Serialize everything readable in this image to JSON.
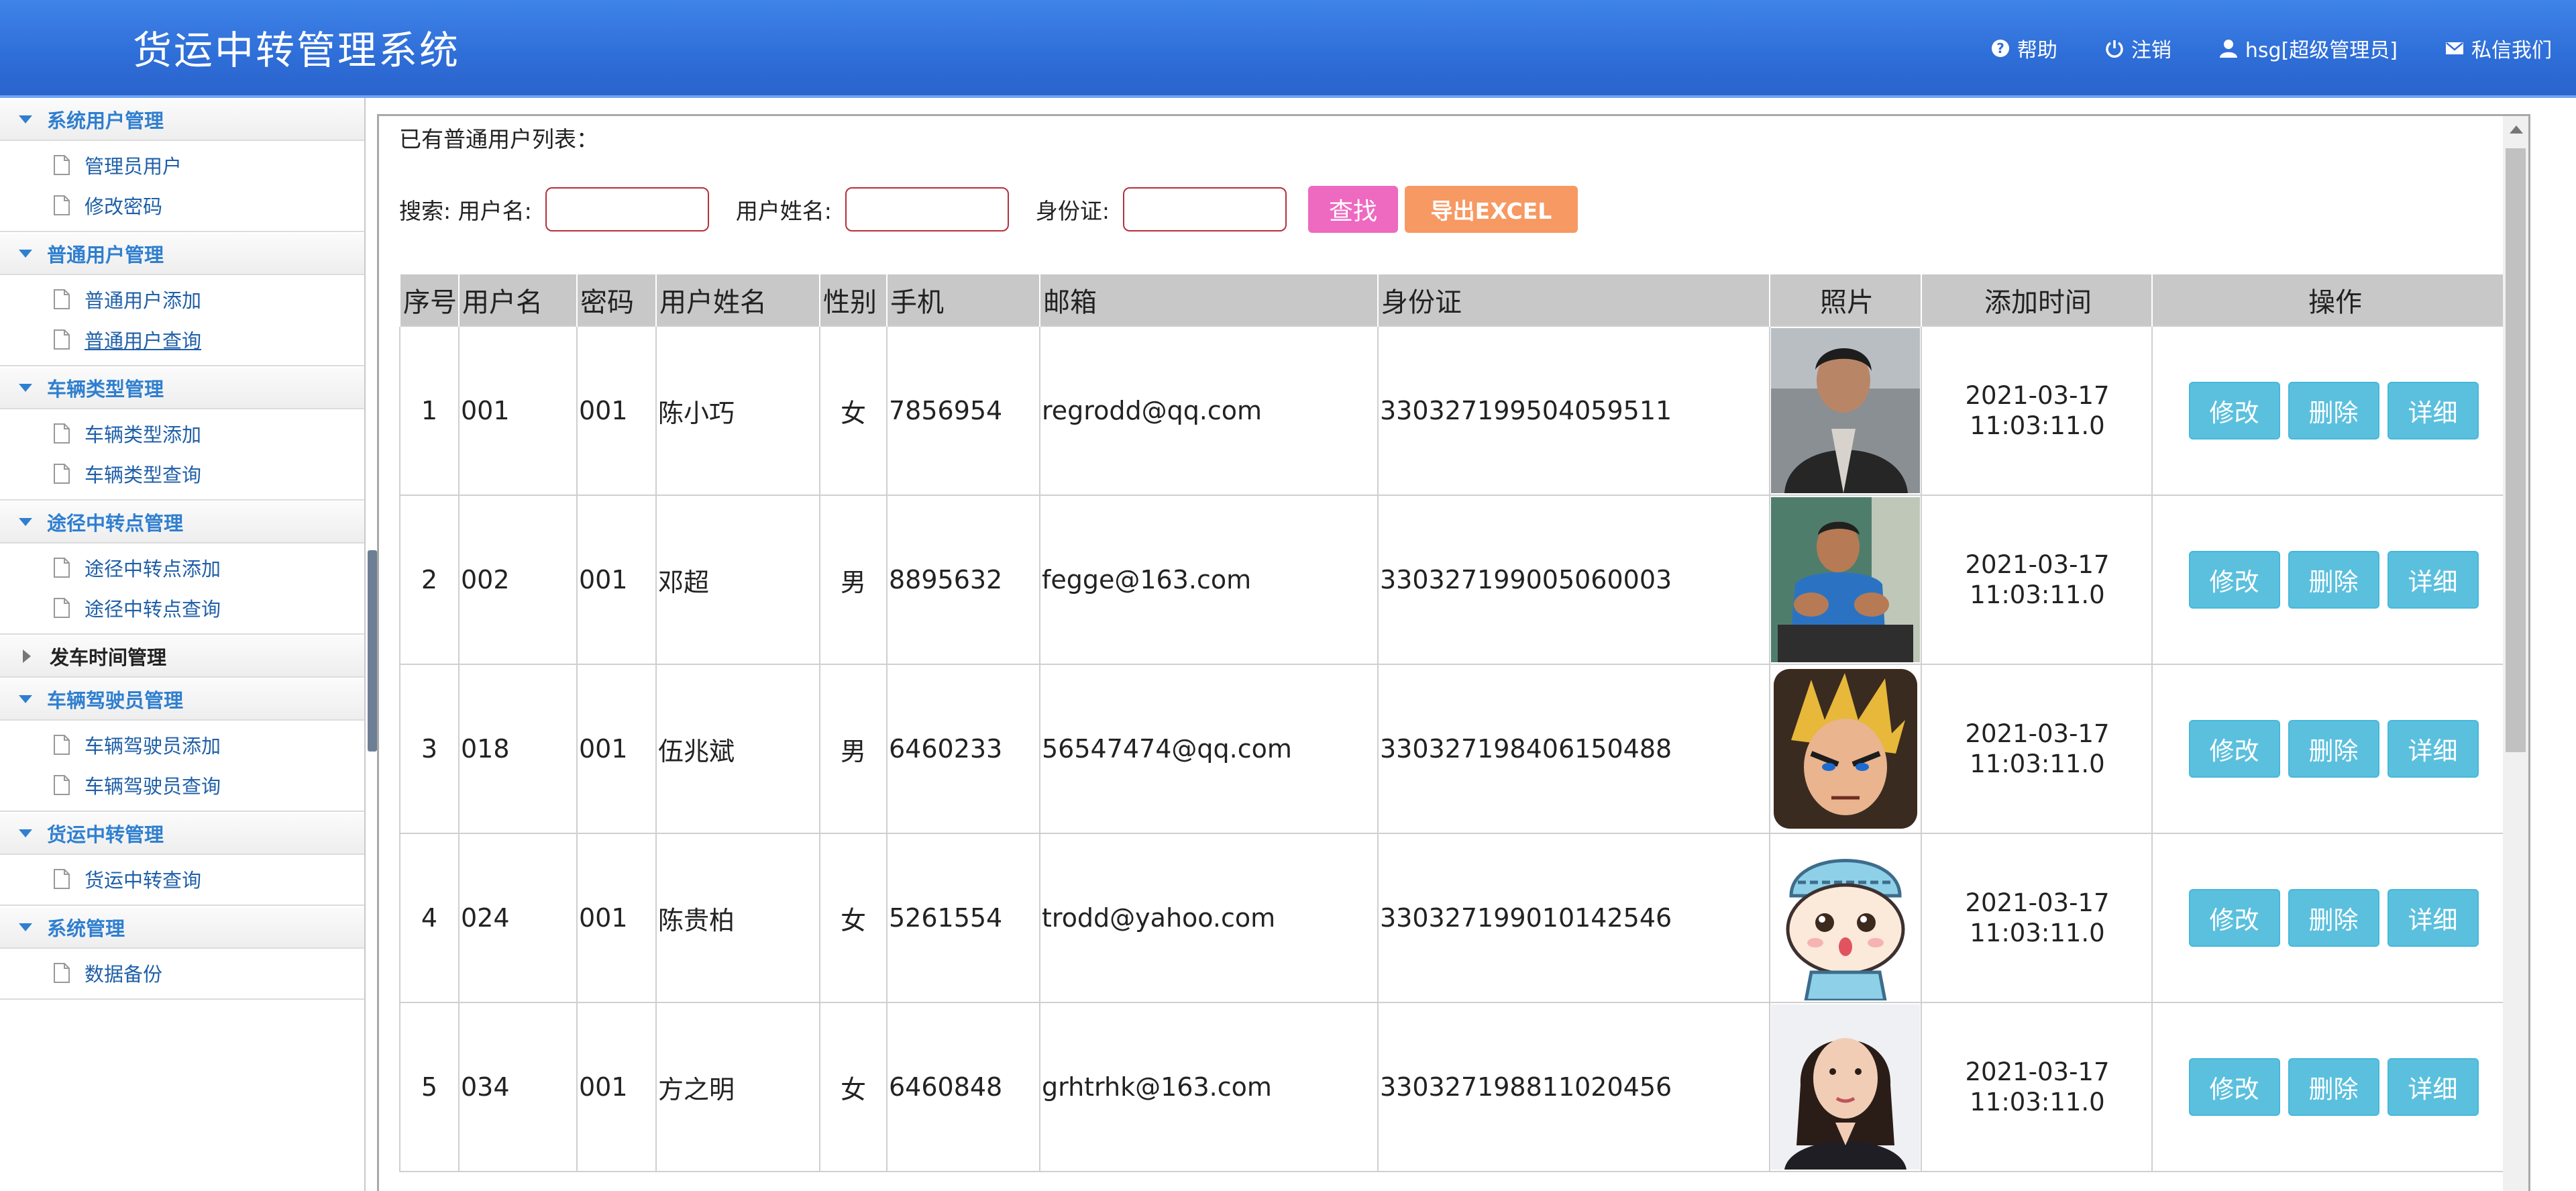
{
  "header": {
    "title": "货运中转管理系统",
    "nav": [
      {
        "label": "帮助",
        "icon": "help-icon"
      },
      {
        "label": "注销",
        "icon": "power-icon"
      },
      {
        "label": "hsg[超级管理员]",
        "icon": "user-icon"
      },
      {
        "label": "私信我们",
        "icon": "mail-icon"
      }
    ],
    "colors": {
      "bar": "#2f6fd9",
      "text": "#ffffff"
    }
  },
  "sidebar": {
    "groups": [
      {
        "label": "系统用户管理",
        "items": [
          "管理员用户",
          "修改密码"
        ]
      },
      {
        "label": "普通用户管理",
        "items": [
          "普通用户添加",
          "普通用户查询"
        ]
      },
      {
        "label": "车辆类型管理",
        "items": [
          "车辆类型添加",
          "车辆类型查询"
        ]
      },
      {
        "label": "途径中转点管理",
        "items": [
          "途径中转点添加",
          "途径中转点查询"
        ]
      },
      {
        "label": "发车时间管理",
        "items": []
      },
      {
        "label": "车辆驾驶员管理",
        "items": [
          "车辆驾驶员添加",
          "车辆驾驶员查询"
        ]
      },
      {
        "label": "货运中转管理",
        "items": [
          "货运中转查询"
        ]
      },
      {
        "label": "系统管理",
        "items": [
          "数据备份"
        ]
      }
    ]
  },
  "main": {
    "list_title": "已有普通用户列表：",
    "search": {
      "prefix": "搜索: 用户名:",
      "name_label": "用户姓名:",
      "id_label": "身份证:",
      "username_value": "",
      "name_value": "",
      "id_value": "",
      "find_button": "查找",
      "export_button": "导出EXCEL"
    },
    "table": {
      "columns": [
        "序号",
        "用户名",
        "密码",
        "用户姓名",
        "性别",
        "手机",
        "邮箱",
        "身份证",
        "照片",
        "添加时间",
        "操作"
      ],
      "rows": [
        {
          "no": "1",
          "username": "001",
          "password": "001",
          "name": "陈小巧",
          "gender": "女",
          "phone": "7856954",
          "email": "regrodd@qq.com",
          "idcard": "330327199504059511",
          "time1": "2021-03-17",
          "time2": "11:03:11.0"
        },
        {
          "no": "2",
          "username": "002",
          "password": "001",
          "name": "邓超",
          "gender": "男",
          "phone": "8895632",
          "email": "fegge@163.com",
          "idcard": "330327199005060003",
          "time1": "2021-03-17",
          "time2": "11:03:11.0"
        },
        {
          "no": "3",
          "username": "018",
          "password": "001",
          "name": "伍兆斌",
          "gender": "男",
          "phone": "6460233",
          "email": "56547474@qq.com",
          "idcard": "330327198406150488",
          "time1": "2021-03-17",
          "time2": "11:03:11.0"
        },
        {
          "no": "4",
          "username": "024",
          "password": "001",
          "name": "陈贵柏",
          "gender": "女",
          "phone": "5261554",
          "email": "trodd@yahoo.com",
          "idcard": "330327199010142546",
          "time1": "2021-03-17",
          "time2": "11:03:11.0"
        },
        {
          "no": "5",
          "username": "034",
          "password": "001",
          "name": "方之明",
          "gender": "女",
          "phone": "6460848",
          "email": "grhtrhk@163.com",
          "idcard": "330327198811020456",
          "time1": "2021-03-17",
          "time2": "11:03:11.0"
        }
      ],
      "actions": {
        "edit": "修改",
        "delete": "删除",
        "detail": "详细"
      }
    }
  }
}
